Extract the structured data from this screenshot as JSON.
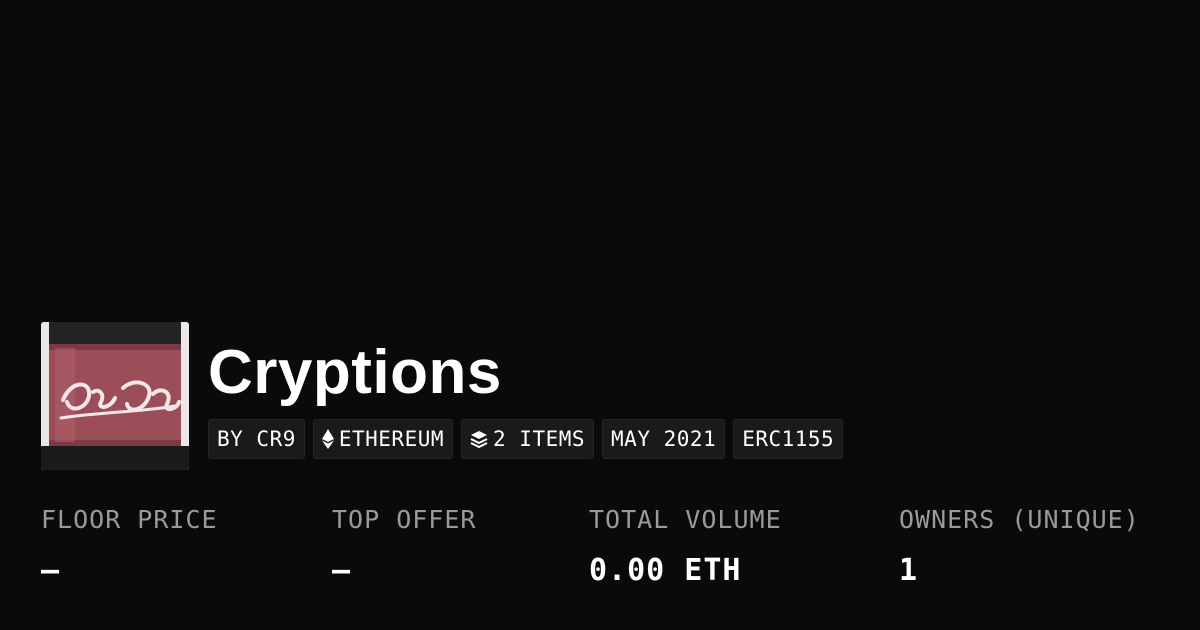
{
  "collection": {
    "title": "Cryptions",
    "thumbnail_icon": "coca-cola-bottle-image",
    "tags": [
      {
        "label": "BY CR9"
      },
      {
        "icon": "ethereum-icon",
        "label": "ETHEREUM"
      },
      {
        "icon": "layers-icon",
        "label": "2 ITEMS"
      },
      {
        "label": "MAY 2021"
      },
      {
        "label": "ERC1155"
      }
    ]
  },
  "stats": {
    "floor_price": {
      "label": "FLOOR PRICE",
      "value": "–"
    },
    "top_offer": {
      "label": "TOP OFFER",
      "value": "–"
    },
    "total_volume": {
      "label": "TOTAL VOLUME",
      "value": "0.00 ETH"
    },
    "owners": {
      "label": "OWNERS (UNIQUE)",
      "value": "1"
    }
  },
  "colors": {
    "background": "#0a0a0a",
    "tag_background": "#1a1a1a",
    "label_gray": "#9a9a9a",
    "text": "#ffffff"
  }
}
